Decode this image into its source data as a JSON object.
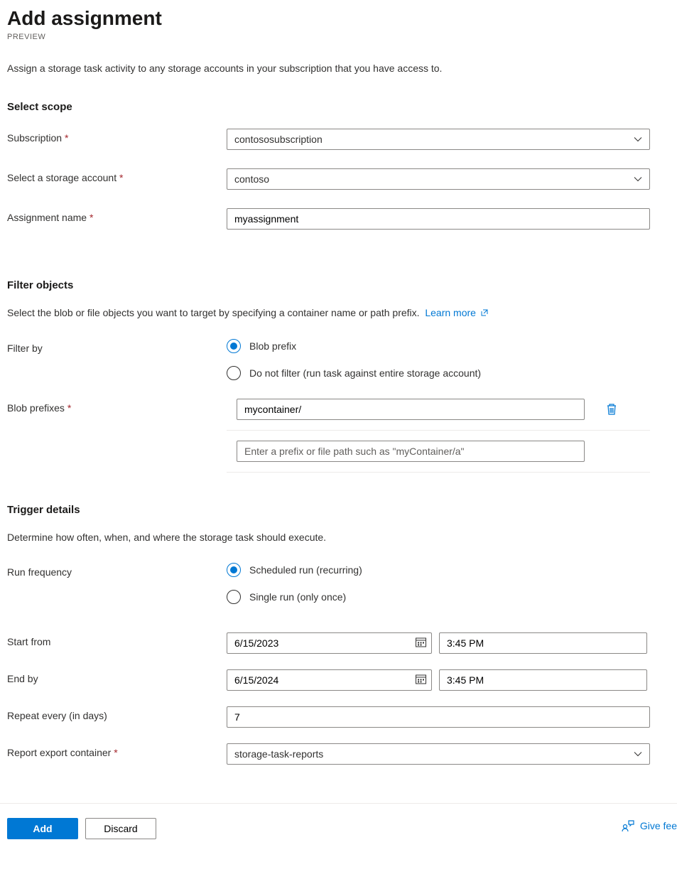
{
  "header": {
    "title": "Add assignment",
    "preview": "PREVIEW",
    "description": "Assign a storage task activity to any storage accounts in your subscription that you have access to."
  },
  "selectScope": {
    "heading": "Select scope",
    "subscription": {
      "label": "Subscription",
      "value": "contososubscription"
    },
    "storageAccount": {
      "label": "Select a storage account",
      "value": "contoso"
    },
    "assignmentName": {
      "label": "Assignment name",
      "value": "myassignment"
    }
  },
  "filterObjects": {
    "heading": "Filter objects",
    "description": "Select the blob or file objects you want to target by specifying a container name or path prefix.",
    "learnMore": "Learn more",
    "filterByLabel": "Filter by",
    "options": {
      "blobPrefix": "Blob prefix",
      "doNotFilter": "Do not filter (run task against entire storage account)"
    },
    "blobPrefixesLabel": "Blob prefixes",
    "prefixes": [
      "mycontainer/"
    ],
    "prefixPlaceholder": "Enter a prefix or file path such as \"myContainer/a\""
  },
  "triggerDetails": {
    "heading": "Trigger details",
    "description": "Determine how often, when, and where the storage task should execute.",
    "runFrequencyLabel": "Run frequency",
    "options": {
      "scheduled": "Scheduled run (recurring)",
      "single": "Single run (only once)"
    },
    "startFrom": {
      "label": "Start from",
      "date": "6/15/2023",
      "time": "3:45 PM"
    },
    "endBy": {
      "label": "End by",
      "date": "6/15/2024",
      "time": "3:45 PM"
    },
    "repeatEvery": {
      "label": "Repeat every (in days)",
      "value": "7"
    },
    "reportContainer": {
      "label": "Report export container",
      "value": "storage-task-reports"
    }
  },
  "footer": {
    "add": "Add",
    "discard": "Discard",
    "feedback": "Give fee"
  }
}
